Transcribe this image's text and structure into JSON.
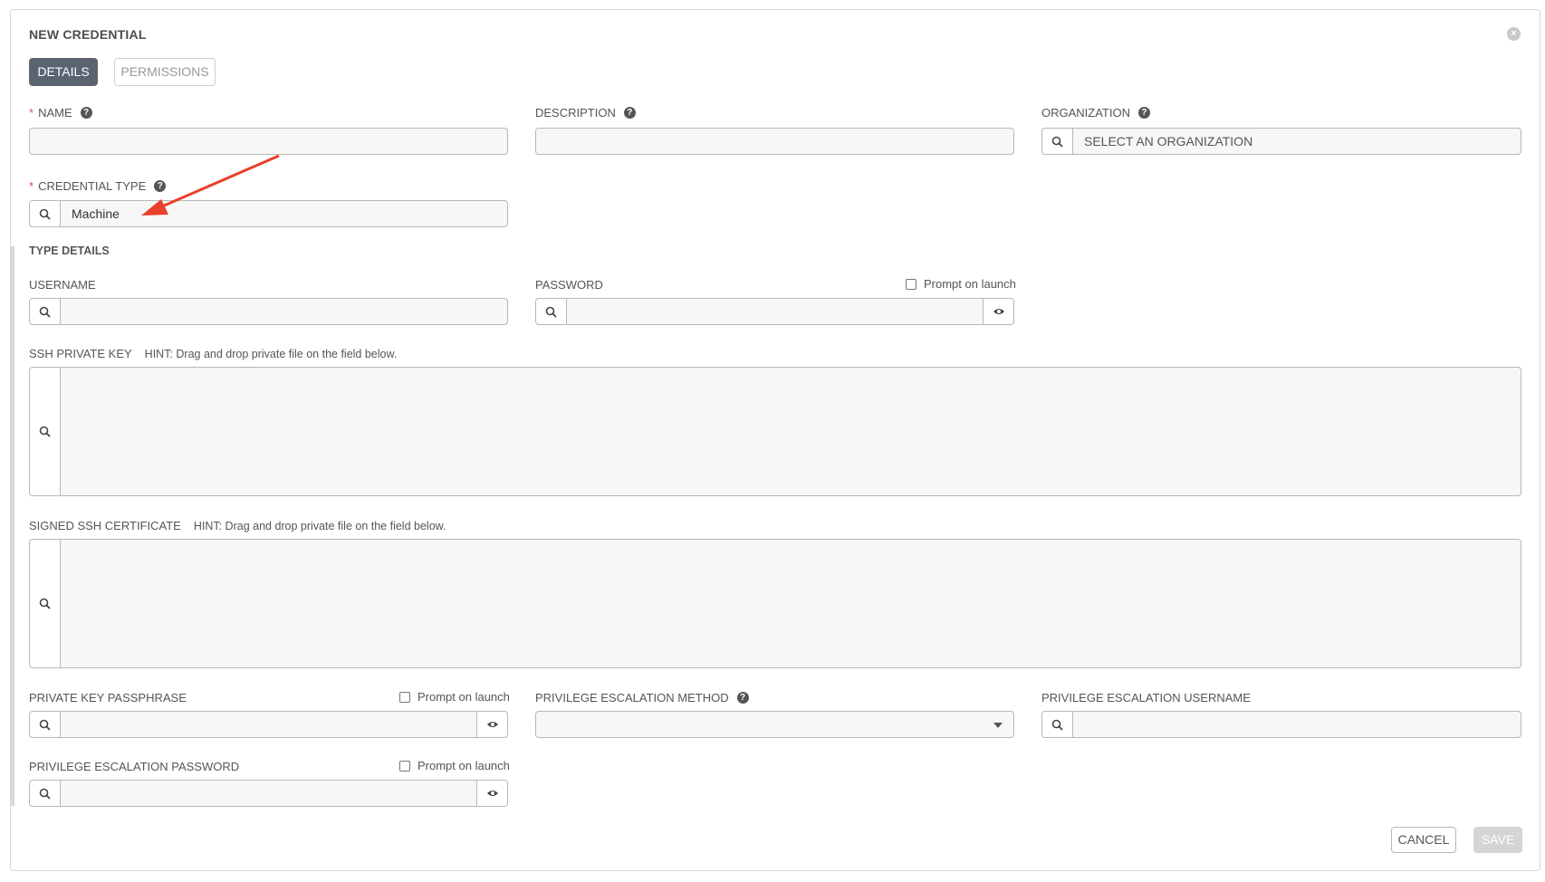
{
  "dialog": {
    "title": "NEW CREDENTIAL",
    "close_glyph": "×"
  },
  "tabs": [
    {
      "label": "DETAILS",
      "active": true
    },
    {
      "label": "PERMISSIONS",
      "active": false
    }
  ],
  "fields": {
    "name": {
      "label": "NAME",
      "required": true,
      "value": ""
    },
    "description": {
      "label": "DESCRIPTION",
      "value": ""
    },
    "organization": {
      "label": "ORGANIZATION",
      "placeholder": "SELECT AN ORGANIZATION"
    },
    "credential_type": {
      "label": "CREDENTIAL TYPE",
      "required": true,
      "value": "Machine"
    }
  },
  "type_details": {
    "title": "TYPE DETAILS",
    "username": {
      "label": "USERNAME",
      "value": ""
    },
    "password": {
      "label": "PASSWORD",
      "prompt_label": "Prompt on launch",
      "prompt_checked": false
    },
    "ssh_private_key": {
      "label": "SSH PRIVATE KEY",
      "hint": "HINT: Drag and drop private file on the field below."
    },
    "signed_ssh_certificate": {
      "label": "SIGNED SSH CERTIFICATE",
      "hint": "HINT: Drag and drop private file on the field below."
    },
    "private_key_passphrase": {
      "label": "PRIVATE KEY PASSPHRASE",
      "prompt_label": "Prompt on launch",
      "prompt_checked": false
    },
    "privilege_escalation_method": {
      "label": "PRIVILEGE ESCALATION METHOD",
      "selected": ""
    },
    "privilege_escalation_username": {
      "label": "PRIVILEGE ESCALATION USERNAME",
      "value": ""
    },
    "privilege_escalation_password": {
      "label": "PRIVILEGE ESCALATION PASSWORD",
      "prompt_label": "Prompt on launch",
      "prompt_checked": false
    }
  },
  "actions": {
    "cancel_label": "CANCEL",
    "save_label": "SAVE"
  },
  "colors": {
    "required_asterisk": "#d9534f",
    "annotation_arrow": "#e8402a",
    "active_tab": "#5c6370",
    "save_disabled": "#d5d5d5"
  },
  "icons": [
    "close-icon",
    "help-icon",
    "search-icon",
    "eye-icon",
    "chevron-down-icon",
    "arrow-annotation"
  ]
}
